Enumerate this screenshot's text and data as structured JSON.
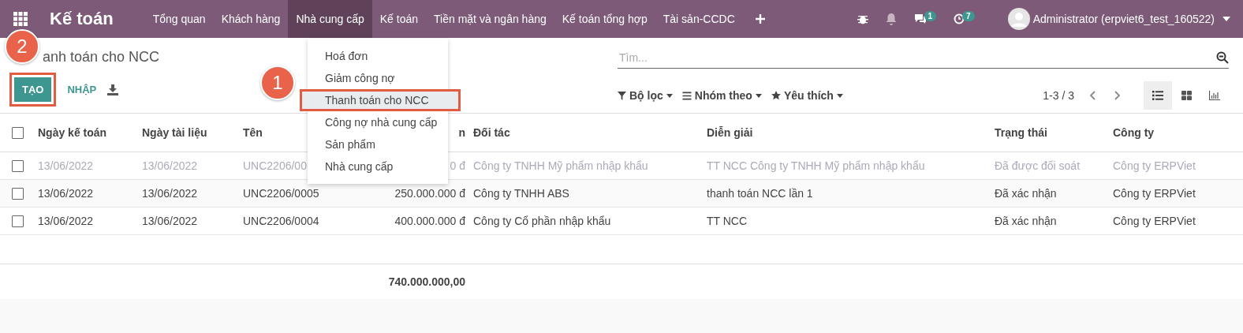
{
  "navbar": {
    "app_title": "Kế toán",
    "menu": [
      {
        "label": "Tổng quan",
        "selected": false
      },
      {
        "label": "Khách hàng",
        "selected": false
      },
      {
        "label": "Nhà cung cấp",
        "selected": true
      },
      {
        "label": "Kế toán",
        "selected": false
      },
      {
        "label": "Tiền mặt và ngân hàng",
        "selected": false
      },
      {
        "label": "Kế toán tổng hợp",
        "selected": false
      },
      {
        "label": "Tài sản-CCDC",
        "selected": false
      }
    ],
    "messages_count": "1",
    "activities_count": "7",
    "user": "Administrator (erpviet6_test_160522)"
  },
  "dropdown": {
    "items": [
      {
        "label": "Hoá đơn",
        "selected": false
      },
      {
        "label": "Giảm công nợ",
        "selected": false
      },
      {
        "label": "Thanh toán cho NCC",
        "selected": true
      },
      {
        "label": "Công nợ nhà cung cấp",
        "selected": false
      },
      {
        "label": "Sản phẩm",
        "selected": false
      },
      {
        "label": "Nhà cung cấp",
        "selected": false
      }
    ]
  },
  "breadcrumb": "anh toán cho NCC",
  "buttons": {
    "create": "TẠO",
    "import": "NHẬP"
  },
  "search": {
    "placeholder": "Tìm..."
  },
  "filters": [
    {
      "kind": "filter",
      "label": "Bộ lọc"
    },
    {
      "kind": "group",
      "label": "Nhóm theo"
    },
    {
      "kind": "favorite",
      "label": "Yêu thích"
    }
  ],
  "pager": "1-3 / 3",
  "views": [
    {
      "kind": "list",
      "selected": true
    },
    {
      "kind": "kanban",
      "selected": false
    },
    {
      "kind": "graph",
      "selected": false
    }
  ],
  "table": {
    "header_checked": false,
    "columns": [
      "Ngày kế toán",
      "Ngày tài liệu",
      "Tên",
      "n",
      "Đối tác",
      "Diễn giải",
      "Trạng thái",
      "Công ty"
    ],
    "rows": [
      {
        "checked": false,
        "muted": true,
        "cells": [
          "13/06/2022",
          "13/06/2022",
          "UNC2206/00",
          "0 đ",
          "Công ty TNHH Mỹ phẩm nhập khẩu",
          "TT NCC Công ty TNHH Mỹ phẩm nhập khẩu",
          "Đã được đối soát",
          "Công ty ERPViet"
        ]
      },
      {
        "checked": false,
        "muted": false,
        "cells": [
          "13/06/2022",
          "13/06/2022",
          "UNC2206/0005",
          "250.000.000 đ",
          "Công ty TNHH ABS",
          "thanh toán NCC lần 1",
          "Đã xác nhận",
          "Công ty ERPViet"
        ]
      },
      {
        "checked": false,
        "muted": false,
        "cells": [
          "13/06/2022",
          "13/06/2022",
          "UNC2206/0004",
          "400.000.000 đ",
          "Công ty Cổ phần nhập khẩu",
          "TT NCC",
          "Đã xác nhận",
          "Công ty ERPViet"
        ]
      }
    ],
    "total": "740.000.000,00"
  },
  "annotations": [
    {
      "label": "1"
    },
    {
      "label": "2"
    }
  ]
}
